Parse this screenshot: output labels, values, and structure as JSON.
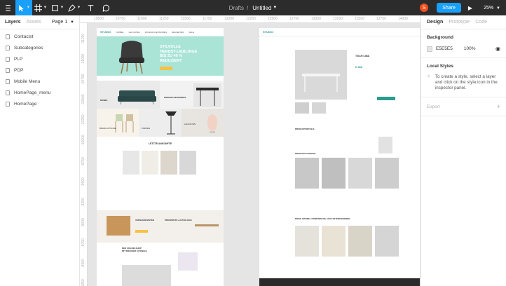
{
  "toolbar": {
    "breadcrumb": "Drafts",
    "file_name": "Untitled",
    "avatar_initial": "S",
    "share_label": "Share",
    "zoom": "25%"
  },
  "left_panel": {
    "tabs": [
      {
        "label": "Layers"
      },
      {
        "label": "Assets"
      }
    ],
    "page_selector": "Page 1",
    "pages": [
      {
        "label": "Contactst"
      },
      {
        "label": "Subcategories"
      },
      {
        "label": "PLP"
      },
      {
        "label": "PDP"
      },
      {
        "label": "Mobile Menu"
      },
      {
        "label": "HomePage_menu"
      },
      {
        "label": "HomePage"
      }
    ]
  },
  "ruler": {
    "top": [
      "10500",
      "10750",
      "11000",
      "11250",
      "11500",
      "11750",
      "12000",
      "12250",
      "12500",
      "12750",
      "13000",
      "13250",
      "13500",
      "13750",
      "14000",
      "14250"
    ],
    "left": [
      "-11250",
      "-11000",
      "-10750",
      "-10500",
      "-10250",
      "-10000",
      "-9750",
      "-9500",
      "-9250",
      "-9000",
      "-8750",
      "-8500",
      "-8250"
    ]
  },
  "canvas": {
    "homepage": {
      "logo": "STUDIO",
      "nav_links": [
        "MÖBEL",
        "LEUCHTEN",
        "WOHNACCESSOIRES",
        "NEUHEITEN",
        "SALE"
      ],
      "hero_title": "STILVOLLE\nHERBST-LIEBLINGE\nBIS ZU 40 %\nREDUZIERT",
      "categories": [
        "MOBEL",
        "WOHNACCESSOIRES",
        "BRANCHTISCHE",
        "PARKEN",
        "LEUCHTEN"
      ],
      "section_latest": "LETZTE ANKÜNFTE",
      "info_1": "VERSANDKOSTEN",
      "info_2": "PROSPEKTE & KATALOGE",
      "shop_title": "DER ONLINE-SHOP\nMIT RIESIGER AUSWAHL"
    },
    "pdp": {
      "product_name": "TISCH LIMA",
      "price": "€ 380",
      "section_details": "PRODUKTDETAILS",
      "section_related": "PRODUKTAUSWAHL",
      "section_similar": "DIESE ARTIKEL KÖNNTEN SIE AUCH INTERESSIEREN"
    }
  },
  "right_panel": {
    "tabs": [
      {
        "label": "Design"
      },
      {
        "label": "Prototype"
      },
      {
        "label": "Code"
      }
    ],
    "background": {
      "heading": "Background",
      "hex": "E5E5E5",
      "opacity": "100%",
      "color": "#e5e5e5"
    },
    "local_styles": {
      "heading": "Local Styles",
      "hint": "To create a style, select a layer and click on the style icon in the inspector panel."
    },
    "export": {
      "heading": "Export"
    }
  },
  "colors": {
    "accent": "#18a0fb",
    "toolbar": "#2c2c2c",
    "avatar": "#f24e1e",
    "hero": "#a9e4d7"
  }
}
